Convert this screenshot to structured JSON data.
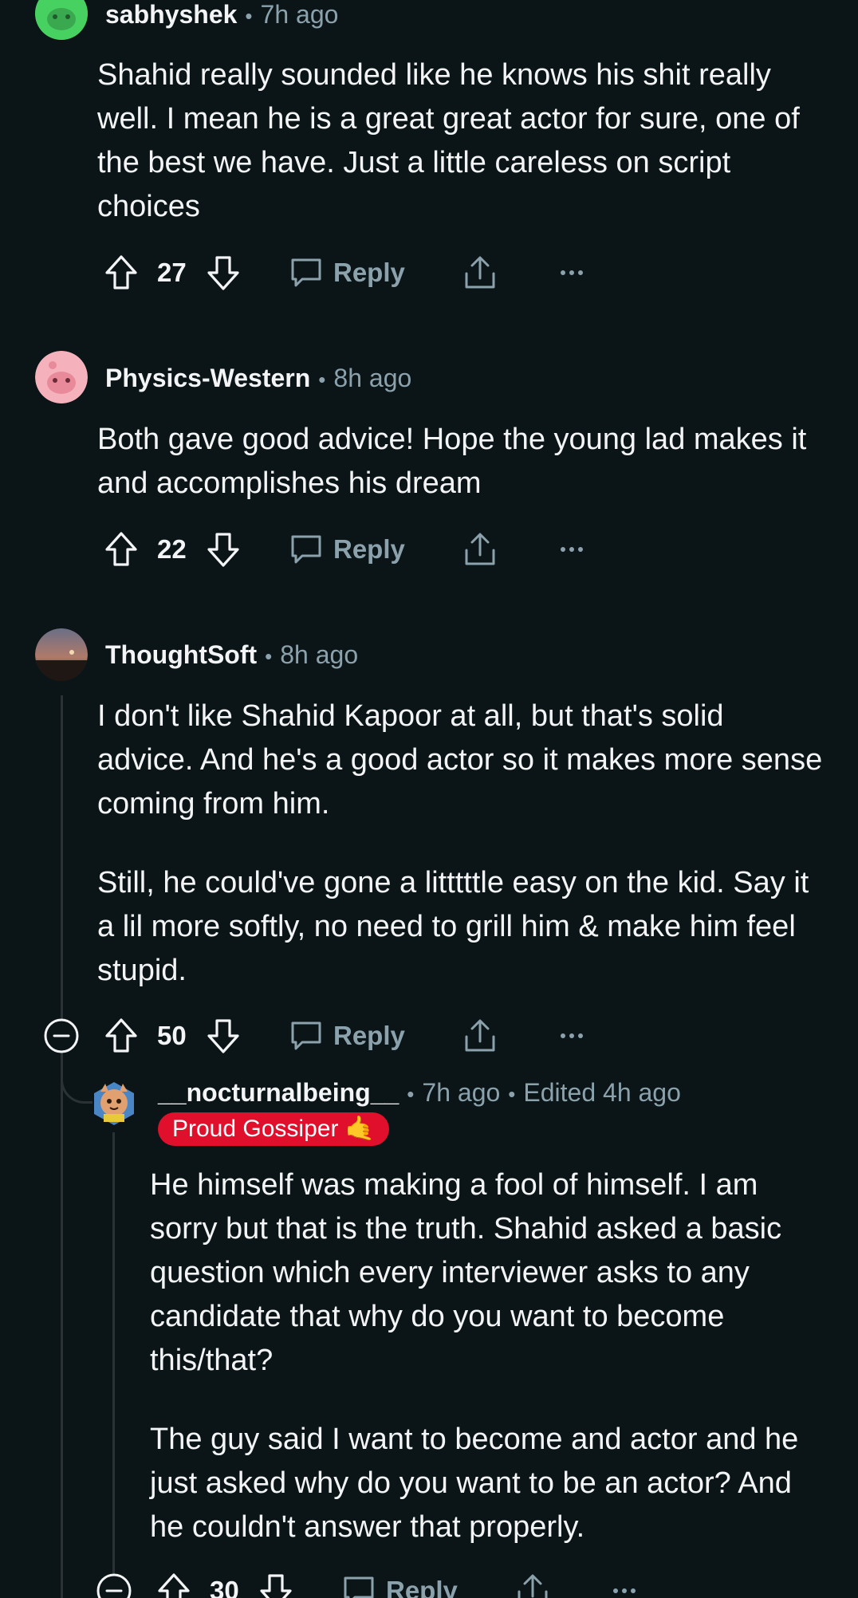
{
  "comments": [
    {
      "user": "sabhyshek",
      "time": "7h ago",
      "paragraphs": [
        "Shahid really sounded like he knows his shit really well. I mean he is a great great actor for sure, one of the best we have. Just a little careless on script choices"
      ],
      "votes": "27",
      "reply": "Reply"
    },
    {
      "user": "Physics-Western",
      "time": "8h ago",
      "paragraphs": [
        "Both gave good advice! Hope the young lad makes it and accomplishes his dream"
      ],
      "votes": "22",
      "reply": "Reply"
    },
    {
      "user": "ThoughtSoft",
      "time": "8h ago",
      "paragraphs": [
        "I don't like Shahid Kapoor at all, but that's solid advice. And he's a good actor so it makes more sense coming from him.",
        "Still, he could've gone a litttttle easy on the kid. Say it a lil more softly, no need to grill him & make him feel stupid."
      ],
      "votes": "50",
      "reply": "Reply"
    },
    {
      "user": "__nocturnalbeing__",
      "time": "7h ago",
      "edited": "Edited 4h ago",
      "flair": "Proud Gossiper 🤙",
      "paragraphs": [
        "He himself was making a fool of himself. I am sorry but that is the truth. Shahid asked a basic question which every interviewer asks to any candidate that why do you want to become this/that?",
        "The guy said I want to become and actor and he just asked why do you want to be an actor? And he couldn't answer that properly."
      ],
      "votes": "30",
      "reply": "Reply"
    }
  ],
  "icons": {
    "upvote": "upvote-icon",
    "downvote": "downvote-icon",
    "reply": "reply-bubble-icon",
    "share": "share-icon",
    "more": "more-options-icon",
    "collapse": "collapse-thread-icon"
  },
  "colors": {
    "background": "#0b1416",
    "muted": "#8ba2ad",
    "flair_bg": "#e0102c",
    "thread_line": "#2a3236"
  }
}
